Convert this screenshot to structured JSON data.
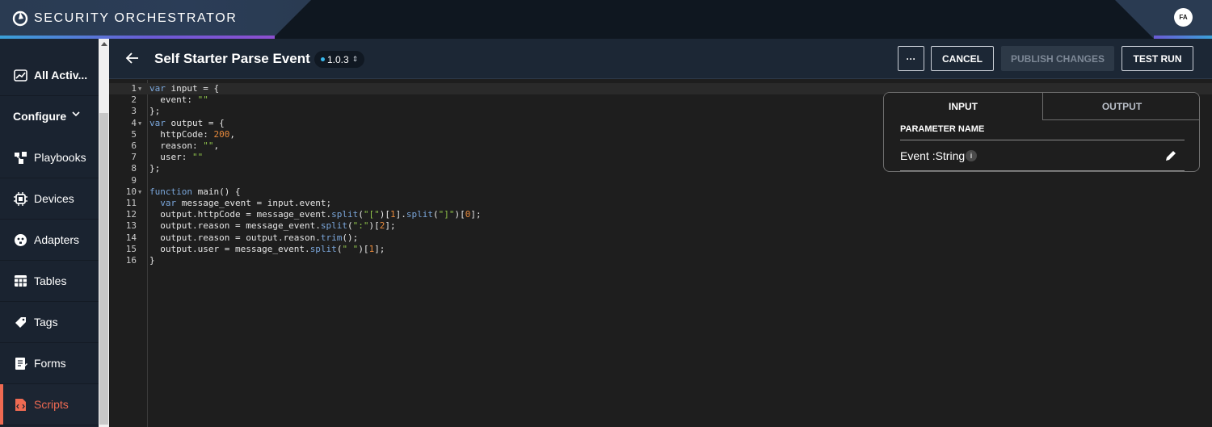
{
  "app": {
    "title": "SECURITY ORCHESTRATOR",
    "user_initials": "FA"
  },
  "sidebar": {
    "items": [
      {
        "label": "All Activ...",
        "icon": "chart-icon",
        "active": false
      },
      {
        "label": "Playbooks",
        "icon": "playbook-icon",
        "active": false
      },
      {
        "label": "Devices",
        "icon": "chip-icon",
        "active": false
      },
      {
        "label": "Adapters",
        "icon": "plug-icon",
        "active": false
      },
      {
        "label": "Tables",
        "icon": "table-icon",
        "active": false
      },
      {
        "label": "Tags",
        "icon": "tag-icon",
        "active": false
      },
      {
        "label": "Forms",
        "icon": "form-icon",
        "active": false
      },
      {
        "label": "Scripts",
        "icon": "script-icon",
        "active": true
      }
    ],
    "configure_label": "Configure"
  },
  "header": {
    "title": "Self Starter Parse Event",
    "version": "1.0.3",
    "more_label": "···",
    "cancel_label": "CANCEL",
    "publish_label": "PUBLISH CHANGES",
    "test_run_label": "TEST RUN"
  },
  "editor": {
    "lines": [
      {
        "n": "1",
        "fold": true
      },
      {
        "n": "2",
        "fold": false
      },
      {
        "n": "3",
        "fold": false
      },
      {
        "n": "4",
        "fold": true
      },
      {
        "n": "5",
        "fold": false
      },
      {
        "n": "6",
        "fold": false
      },
      {
        "n": "7",
        "fold": false
      },
      {
        "n": "8",
        "fold": false
      },
      {
        "n": "9",
        "fold": false
      },
      {
        "n": "10",
        "fold": true
      },
      {
        "n": "11",
        "fold": false
      },
      {
        "n": "12",
        "fold": false
      },
      {
        "n": "13",
        "fold": false
      },
      {
        "n": "14",
        "fold": false
      },
      {
        "n": "15",
        "fold": false
      },
      {
        "n": "16",
        "fold": false
      }
    ],
    "code": [
      "var input = {",
      "  event: \"\"",
      "};",
      "var output = {",
      "  httpCode: 200,",
      "  reason: \"\",",
      "  user: \"\"",
      "};",
      "",
      "function main() {",
      "  var message_event = input.event;",
      "  output.httpCode = message_event.split(\"[\")[1].split(\"]\")[0];",
      "  output.reason = message_event.split(\":\")[2];",
      "  output.reason = output.reason.trim();",
      "  output.user = message_event.split(\" \")[1];",
      "}"
    ]
  },
  "param_panel": {
    "tab_input": "INPUT",
    "tab_output": "OUTPUT",
    "header": "PARAMETER NAME",
    "param": "Event :String",
    "info": "i"
  },
  "colors": {
    "accent_active": "#ef6a52",
    "keyword": "#7aa6da",
    "string": "#8fc24a",
    "number": "#e88a3c"
  }
}
